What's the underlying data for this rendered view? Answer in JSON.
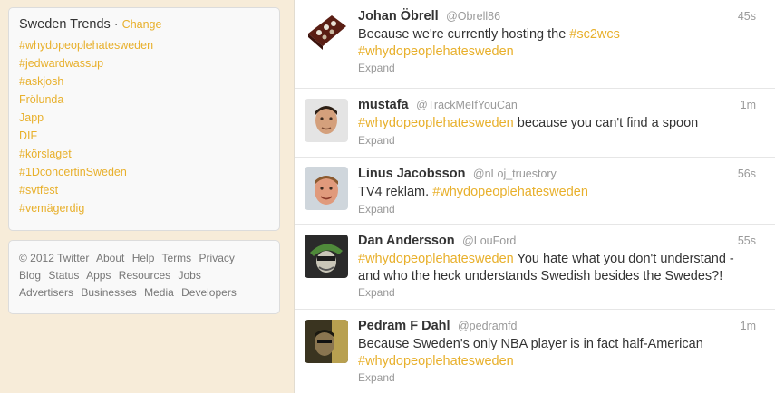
{
  "trends": {
    "title": "Sweden Trends",
    "separator": "·",
    "change_label": "Change",
    "items": [
      "#whydopeoplehatesweden",
      "#jedwardwassup",
      "#askjosh",
      "Frölunda",
      "Japp",
      "DIF",
      "#körslaget",
      "#1DconcertinSweden",
      "#svtfest",
      "#vemägerdig"
    ]
  },
  "footer": {
    "line1": [
      "© 2012 Twitter",
      "About",
      "Help",
      "Terms",
      "Privacy"
    ],
    "line2": [
      "Blog",
      "Status",
      "Apps",
      "Resources",
      "Jobs"
    ],
    "line3": [
      "Advertisers",
      "Businesses",
      "Media",
      "Developers"
    ]
  },
  "tweets": [
    {
      "name": "Johan Öbrell",
      "handle": "@Obrell86",
      "time": "45s",
      "text_before": "Because we're currently hosting the ",
      "hashtag1": "#sc2wcs",
      "text_after": "",
      "hashtag2": "#whydopeoplehatesweden",
      "expand": "Expand"
    },
    {
      "name": "mustafa",
      "handle": "@TrackMeIfYouCan",
      "time": "1m",
      "hashtag": "#whydopeoplehatesweden",
      "text": " because you can't find a spoon",
      "expand": "Expand"
    },
    {
      "name": "Linus Jacobsson",
      "handle": "@nLoj_truestory",
      "time": "56s",
      "text": "TV4 reklam. ",
      "hashtag": "#whydopeoplehatesweden",
      "expand": "Expand"
    },
    {
      "name": "Dan Andersson",
      "handle": "@LouFord",
      "time": "55s",
      "hashtag": "#whydopeoplehatesweden",
      "text": " You hate what you don't understand - and who the heck understands Swedish besides the Swedes?!",
      "expand": "Expand"
    },
    {
      "name": "Pedram F Dahl",
      "handle": "@pedramfd",
      "time": "1m",
      "text": "Because Sweden's only NBA player is in fact half-American",
      "hashtag": "#whydopeoplehatesweden",
      "expand": "Expand"
    }
  ],
  "colors": {
    "background": "#f7ecd9",
    "link": "#e8b02c",
    "text": "#333333",
    "muted": "#999999"
  }
}
